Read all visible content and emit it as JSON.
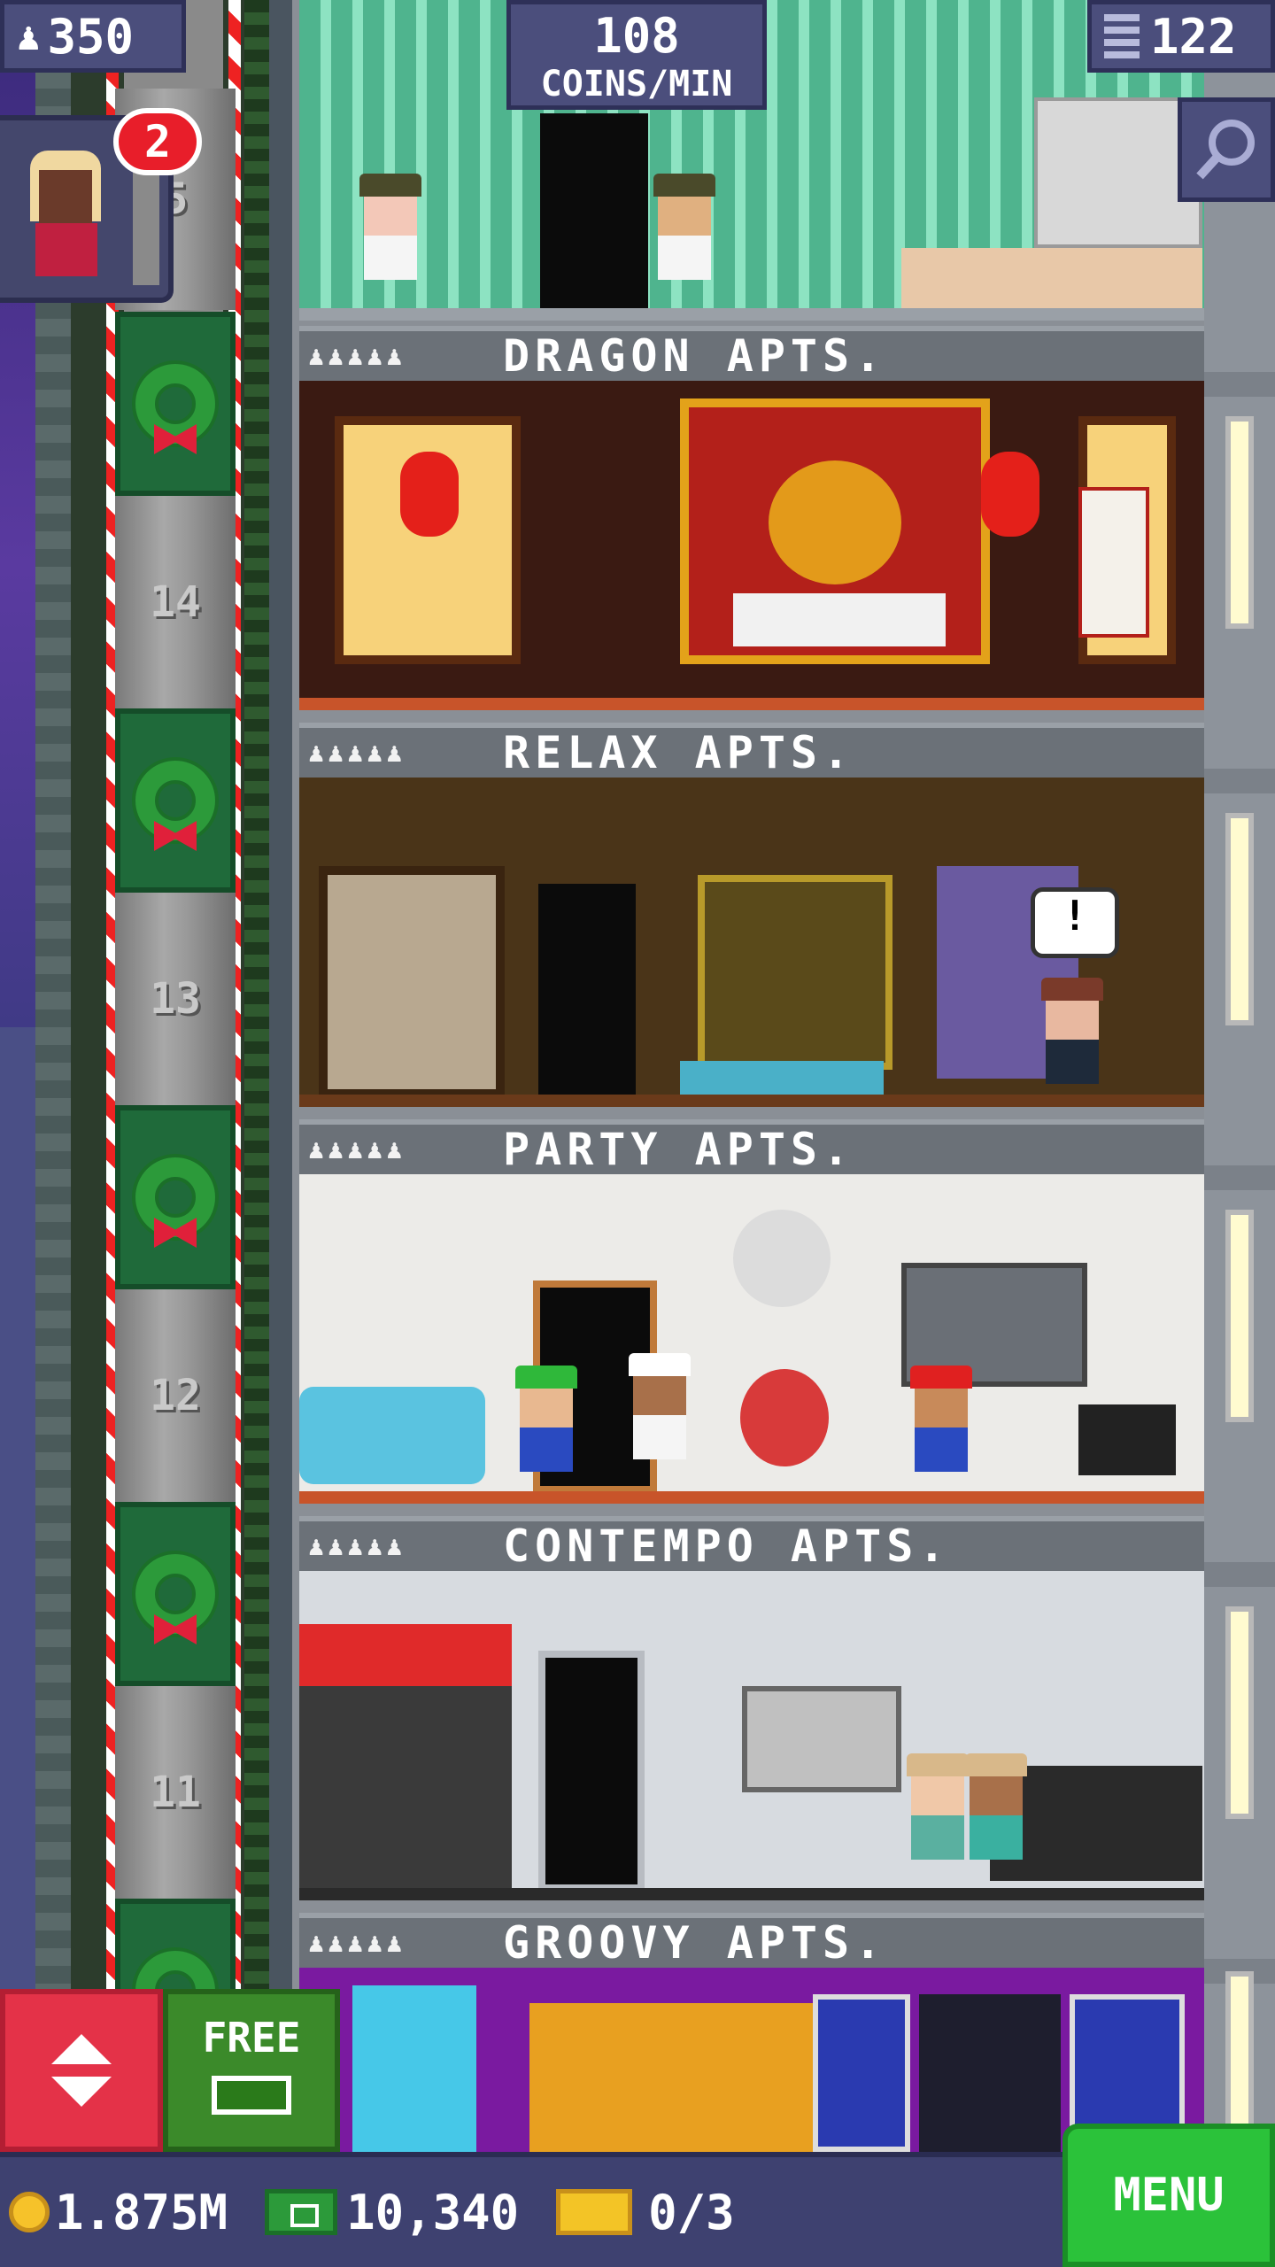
{
  "hud": {
    "population": "350",
    "coins_per_min_value": "108",
    "coins_per_min_label": "COINS/MIN",
    "floors": "122"
  },
  "visitor": {
    "badge": "2"
  },
  "elevator": {
    "floor_numbers": [
      "5",
      "14",
      "13",
      "12",
      "11"
    ]
  },
  "floors": [
    {
      "name": "DRAGON APTS.",
      "people": "♟♟♟♟♟"
    },
    {
      "name": "RELAX APTS.",
      "people": "♟♟♟♟♟"
    },
    {
      "name": "PARTY APTS.",
      "people": "♟♟♟♟♟"
    },
    {
      "name": "CONTEMPO APTS.",
      "people": "♟♟♟♟♟"
    },
    {
      "name": "GROOVY APTS.",
      "people": "♟♟♟♟♟"
    }
  ],
  "relax": {
    "speech": "!"
  },
  "free_button": {
    "label": "FREE"
  },
  "bottom": {
    "coins": "1.875M",
    "bux": "10,340",
    "tickets": "0/3",
    "menu": "MENU"
  },
  "icons": {
    "population": "person-icon",
    "floors": "building-icon",
    "search": "magnifier-icon",
    "coin": "coin-icon",
    "bux": "bux-icon",
    "ticket": "ticket-icon"
  },
  "colors": {
    "hud": "#4b4e7c",
    "elevator_button": "#e43248",
    "free_button": "#3b8a2a",
    "menu_button": "#2bc23a",
    "badge": "#e81e2a"
  }
}
